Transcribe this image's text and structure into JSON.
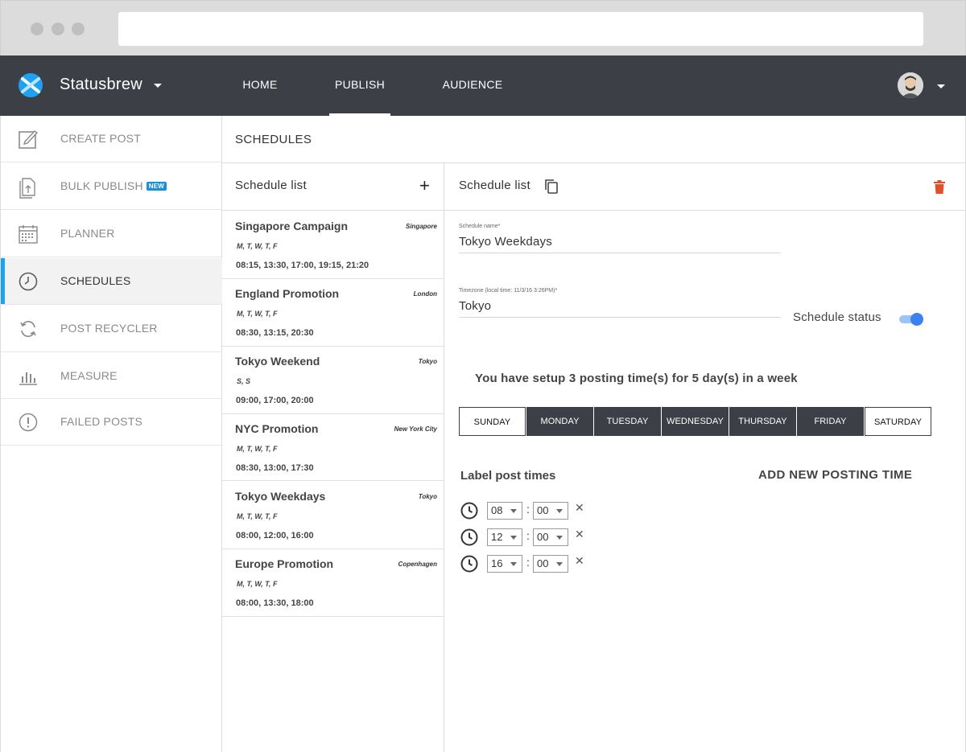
{
  "app": {
    "brand": "Statusbrew"
  },
  "nav": {
    "tabs": [
      "HOME",
      "PUBLISH",
      "AUDIENCE"
    ],
    "active": "PUBLISH"
  },
  "sidebar": {
    "items": [
      {
        "label": "CREATE POST",
        "icon": "edit-icon"
      },
      {
        "label": "BULK PUBLISH",
        "icon": "upload-files-icon",
        "badge": "NEW"
      },
      {
        "label": "PLANNER",
        "icon": "calendar-icon"
      },
      {
        "label": "SCHEDULES",
        "icon": "clock-icon",
        "active": true
      },
      {
        "label": "POST RECYCLER",
        "icon": "recycle-icon"
      },
      {
        "label": "MEASURE",
        "icon": "bar-chart-icon"
      },
      {
        "label": "FAILED POSTS",
        "icon": "alert-icon"
      }
    ]
  },
  "main": {
    "title": "SCHEDULES"
  },
  "schedule_list": {
    "title": "Schedule list",
    "add_label": "+",
    "items": [
      {
        "name": "Singapore Campaign",
        "timezone": "Singapore",
        "days": "M, T, W, T, F",
        "times": "08:15, 13:30, 17:00, 19:15, 21:20"
      },
      {
        "name": "England Promotion",
        "timezone": "London",
        "days": "M, T, W, T, F",
        "times": "08:30, 13:15, 20:30"
      },
      {
        "name": "Tokyo Weekend",
        "timezone": "Tokyo",
        "days": "S, S",
        "times": "09:00, 17:00, 20:00"
      },
      {
        "name": "NYC Promotion",
        "timezone": "New York City",
        "days": "M, T, W, T, F",
        "times": "08:30, 13:00, 17:30"
      },
      {
        "name": "Tokyo Weekdays",
        "timezone": "Tokyo",
        "days": "M, T, W, T, F",
        "times": "08:00, 12:00, 16:00"
      },
      {
        "name": "Europe Promotion",
        "timezone": "Copenhagen",
        "days": "M, T, W, T, F",
        "times": "08:00, 13:30, 18:00"
      }
    ]
  },
  "detail": {
    "title": "Schedule list",
    "schedule_name_label": "Schedule name*",
    "schedule_name": "Tokyo Weekdays",
    "timezone_label": "Timezone (local time: 11/3/16 3:26PM)*",
    "timezone": "Tokyo",
    "status_label": "Schedule status",
    "status_on": true,
    "summary": "You have setup 3 posting time(s) for 5 day(s) in a week",
    "days": [
      {
        "label": "SUNDAY",
        "selected": false
      },
      {
        "label": "MONDAY",
        "selected": true
      },
      {
        "label": "TUESDAY",
        "selected": true
      },
      {
        "label": "WEDNESDAY",
        "selected": true
      },
      {
        "label": "THURSDAY",
        "selected": true
      },
      {
        "label": "FRIDAY",
        "selected": true
      },
      {
        "label": "SATURDAY",
        "selected": false
      }
    ],
    "label_post_times": "Label post times",
    "add_new_time": "ADD NEW POSTING TIME",
    "times": [
      {
        "hour": "08",
        "minute": "00"
      },
      {
        "hour": "12",
        "minute": "00"
      },
      {
        "hour": "16",
        "minute": "00"
      }
    ],
    "colon": ":",
    "remove_glyph": "✕"
  },
  "colors": {
    "nav_bg": "#3d3f46",
    "accent_blue": "#1da1f2",
    "toggle_blue": "#3b82f0",
    "delete_red": "#e0502b",
    "badge_blue": "#1a8fd6"
  }
}
